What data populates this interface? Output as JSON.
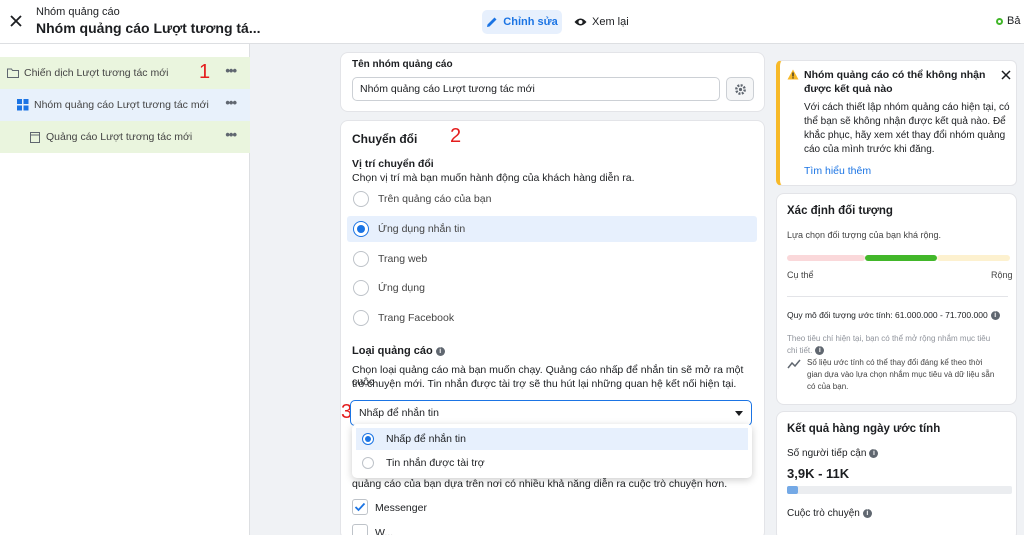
{
  "topbar": {
    "subtitle": "Nhóm quảng cáo",
    "title": "Nhóm quảng cáo Lượt tương tá...",
    "edit_label": "Chỉnh sửa",
    "review_label": "Xem lại",
    "right_label": "Bả"
  },
  "tree": {
    "campaign": "Chiến dịch Lượt tương tác mới",
    "adset": "Nhóm quảng cáo Lượt tương tác mới",
    "ad": "Quảng cáo Lượt tương tác mới",
    "more": "•••"
  },
  "markers": {
    "m1": "1",
    "m2": "2",
    "m3": "3"
  },
  "adset_name": {
    "label": "Tên nhóm quảng cáo",
    "value": "Nhóm quảng cáo Lượt tương tác mới"
  },
  "conversion": {
    "title": "Chuyển đổi",
    "location_label": "Vị trí chuyển đổi",
    "location_help": "Chọn vị trí mà bạn muốn hành động của khách hàng diễn ra.",
    "options": [
      {
        "label": "Trên quảng cáo của bạn",
        "selected": false
      },
      {
        "label": "Ứng dụng nhắn tin",
        "selected": true
      },
      {
        "label": "Trang web",
        "selected": false
      },
      {
        "label": "Ứng dụng",
        "selected": false
      },
      {
        "label": "Trang Facebook",
        "selected": false
      }
    ],
    "ad_type_label": "Loại quảng cáo",
    "ad_type_help_1": "Chọn loại quảng cáo mà bạn muốn chạy. Quảng cáo nhấp để nhắn tin sẽ mở ra một cuộc",
    "ad_type_help_2": "trò chuyện mới. Tin nhắn được tài trợ sẽ thu hút lại những quan hệ kết nối hiện tại.",
    "dropdown_value": "Nhấp để nhắn tin",
    "dropdown_options": [
      {
        "label": "Nhấp để nhắn tin",
        "selected": true
      },
      {
        "label": "Tin nhắn được tài trợ",
        "selected": false
      }
    ],
    "after_text": "quảng cáo của bạn dựa trên nơi có nhiều khả năng diễn ra cuộc trò chuyện hơn.",
    "messenger_label": "Messenger",
    "partial_label": "W..."
  },
  "warning": {
    "title_1": "Nhóm quảng cáo có thể không nhận",
    "title_2": "được kết quả nào",
    "body_1": "Với cách thiết lập nhóm quảng cáo hiện tại, có",
    "body_2": "thể bạn sẽ không nhận được kết quả nào. Để",
    "body_3": "khắc phục, hãy xem xét thay đổi nhóm quảng",
    "body_4": "cáo của mình trước khi đăng.",
    "link": "Tìm hiểu thêm"
  },
  "audience": {
    "title": "Xác định đối tượng",
    "subtitle": "Lựa chọn đối tượng của bạn khá rộng.",
    "left_label": "Cụ thể",
    "right_label": "Rộng",
    "size": "Quy mô đối tượng ước tính: 61.000.000 - 71.700.000",
    "note_1": "Theo tiêu chí hiện tại, bạn có thể mở rộng nhắm mục tiêu",
    "note_2": "chi tiết.",
    "est_1": "Số liệu ước tính có thể thay đổi đáng kể theo thời",
    "est_2": "gian dựa vào lựa chọn nhắm mục tiêu và dữ liệu sẵn",
    "est_3": "có của bạn."
  },
  "daily": {
    "title": "Kết quả hàng ngày ước tính",
    "reach_label": "Số người tiếp cận",
    "reach_value": "3,9K - 11K",
    "conv_label": "Cuộc trò chuyện"
  },
  "colors": {
    "brand_blue": "#1b74e4",
    "green": "#42b72a",
    "warning_yellow": "#f7b928",
    "marker_red": "#e41e1e"
  }
}
